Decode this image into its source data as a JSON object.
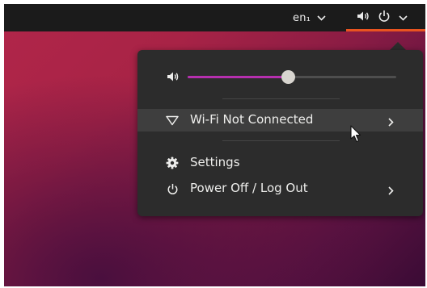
{
  "topbar": {
    "language": "en₁",
    "icons": [
      "chevron-down-icon",
      "speaker-icon",
      "power-icon",
      "chevron-down-icon"
    ],
    "accent_color": "#e95420"
  },
  "system_menu": {
    "volume": {
      "icon": "speaker-icon",
      "level": 0.48,
      "fill_color": "#b62faf"
    },
    "items": [
      {
        "label": "Wi-Fi Not Connected",
        "icon": "wifi-icon",
        "has_submenu": true,
        "highlighted": true
      },
      {
        "label": "Settings",
        "icon": "gear-icon",
        "has_submenu": false
      },
      {
        "label": "Power Off / Log Out",
        "icon": "power-icon",
        "has_submenu": true
      }
    ]
  },
  "colors": {
    "panel_bg": "#1b1b1b",
    "menu_bg": "#2c2c2c",
    "highlight_bg": "#3e3e3e",
    "desktop_primary": "#a82346"
  }
}
